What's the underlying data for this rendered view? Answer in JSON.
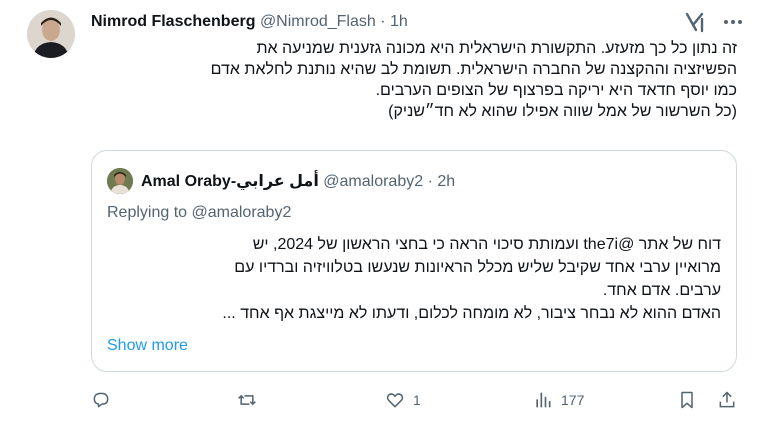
{
  "tweet": {
    "author_name": "Nimrod Flaschenberg",
    "handle": "@Nimrod_Flash",
    "separator": "·",
    "time": "1h",
    "text_lines": [
      "זה נתון כל כך מזעזע. התקשורת הישראלית היא מכונה גזענית שמניעה את",
      "הפשיזציה וההקצנה של החברה הישראלית. תשומת לב שהיא נותנת לחלאת אדם",
      "כמו יוסף חדאד היא יריקה בפרצוף של הצופים הערבים.",
      "(כל השרשור של אמל שווה אפילו שהוא לא חד״שניק)"
    ]
  },
  "quote": {
    "author_name": "Amal Oraby-أمل عرابي",
    "handle": "@amaloraby2",
    "separator": "·",
    "time": "2h",
    "replying_to": "Replying to @amaloraby2",
    "text_lines": [
      "דוח של אתר @the7i  ועמותת סיכוי הראה כי בחצי הראשון של 2024, יש",
      "מרואיין ערבי אחד שקיבל שליש מכלל הראיונות שנעשו בטלוויזיה וברדיו עם",
      "ערבים. אדם אחד.",
      "האדם ההוא לא נבחר ציבור, לא מומחה לכלום, ודעתו לא מייצגת אף אחד ..."
    ],
    "show_more": "Show more"
  },
  "actions": {
    "likes": "1",
    "views": "177"
  },
  "colors": {
    "text": "#0f1419",
    "secondary": "#536471",
    "link": "#1d9bf0",
    "border": "#cfd9de"
  },
  "icons": [
    "grok-icon",
    "more-icon",
    "reply-icon",
    "retweet-icon",
    "like-icon",
    "views-icon",
    "bookmark-icon",
    "share-icon"
  ]
}
